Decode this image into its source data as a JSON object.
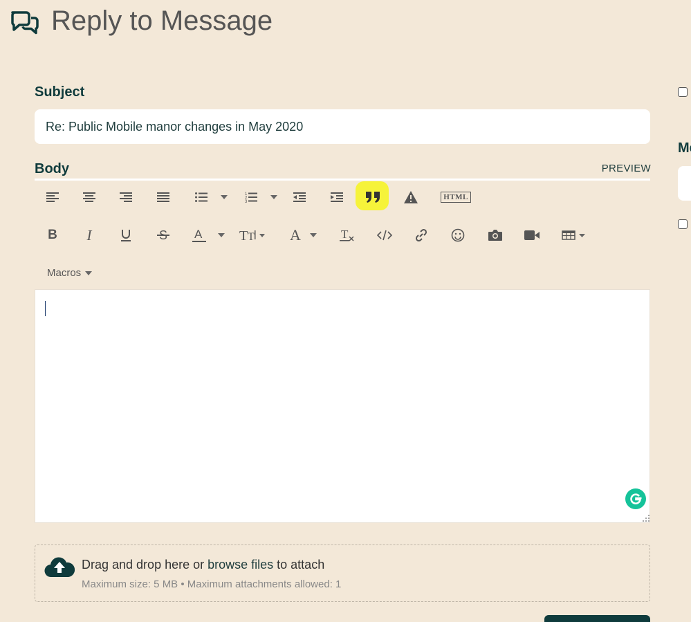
{
  "header": {
    "title": "Reply to Message",
    "icon": "speech-bubbles-icon"
  },
  "subject": {
    "label": "Subject",
    "value": "Re: Public Mobile manor changes in May 2020"
  },
  "body": {
    "label": "Body",
    "preview_label": "PREVIEW"
  },
  "toolbar": {
    "row1": [
      "align-left-icon",
      "align-center-icon",
      "align-right-icon",
      "align-justify-icon",
      "bullet-list-icon",
      "numbered-list-icon",
      "outdent-icon",
      "indent-icon",
      "blockquote-icon",
      "warning-icon",
      "html-icon"
    ],
    "row2": [
      "bold-icon",
      "italic-icon",
      "underline-icon",
      "strikethrough-icon",
      "font-color-icon",
      "font-size-icon",
      "font-family-icon",
      "clear-format-icon",
      "code-icon",
      "link-icon",
      "emoji-icon",
      "camera-icon",
      "video-icon",
      "table-icon"
    ],
    "html_label": "HTML",
    "highlight_color": "#f6f33a",
    "macros_label": "Macros"
  },
  "attachments": {
    "prefix": "Drag and drop here or ",
    "browse_label": "browse files",
    "suffix": " to attach",
    "meta": "Maximum size: 5 MB • Maximum attachments allowed: 1"
  },
  "right_panel": {
    "partial_heading": "Me"
  },
  "colors": {
    "background": "#f3e8d8",
    "accent": "#0f3b3c",
    "grammarly": "#15c39a"
  }
}
